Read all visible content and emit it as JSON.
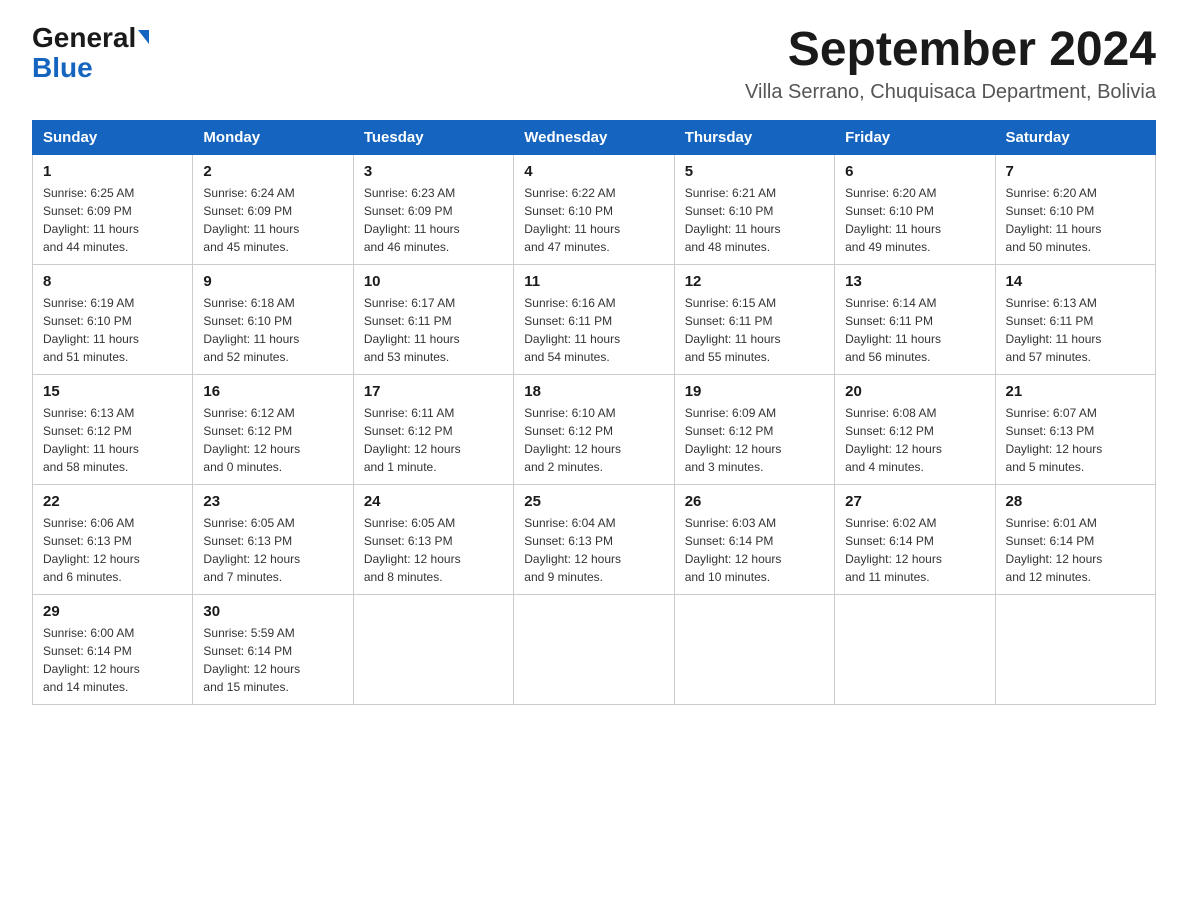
{
  "logo": {
    "general": "General",
    "blue": "Blue",
    "arrow": "▼"
  },
  "header": {
    "month": "September 2024",
    "location": "Villa Serrano, Chuquisaca Department, Bolivia"
  },
  "days_of_week": [
    "Sunday",
    "Monday",
    "Tuesday",
    "Wednesday",
    "Thursday",
    "Friday",
    "Saturday"
  ],
  "weeks": [
    [
      {
        "day": "1",
        "sunrise": "6:25 AM",
        "sunset": "6:09 PM",
        "daylight": "11 hours and 44 minutes."
      },
      {
        "day": "2",
        "sunrise": "6:24 AM",
        "sunset": "6:09 PM",
        "daylight": "11 hours and 45 minutes."
      },
      {
        "day": "3",
        "sunrise": "6:23 AM",
        "sunset": "6:09 PM",
        "daylight": "11 hours and 46 minutes."
      },
      {
        "day": "4",
        "sunrise": "6:22 AM",
        "sunset": "6:10 PM",
        "daylight": "11 hours and 47 minutes."
      },
      {
        "day": "5",
        "sunrise": "6:21 AM",
        "sunset": "6:10 PM",
        "daylight": "11 hours and 48 minutes."
      },
      {
        "day": "6",
        "sunrise": "6:20 AM",
        "sunset": "6:10 PM",
        "daylight": "11 hours and 49 minutes."
      },
      {
        "day": "7",
        "sunrise": "6:20 AM",
        "sunset": "6:10 PM",
        "daylight": "11 hours and 50 minutes."
      }
    ],
    [
      {
        "day": "8",
        "sunrise": "6:19 AM",
        "sunset": "6:10 PM",
        "daylight": "11 hours and 51 minutes."
      },
      {
        "day": "9",
        "sunrise": "6:18 AM",
        "sunset": "6:10 PM",
        "daylight": "11 hours and 52 minutes."
      },
      {
        "day": "10",
        "sunrise": "6:17 AM",
        "sunset": "6:11 PM",
        "daylight": "11 hours and 53 minutes."
      },
      {
        "day": "11",
        "sunrise": "6:16 AM",
        "sunset": "6:11 PM",
        "daylight": "11 hours and 54 minutes."
      },
      {
        "day": "12",
        "sunrise": "6:15 AM",
        "sunset": "6:11 PM",
        "daylight": "11 hours and 55 minutes."
      },
      {
        "day": "13",
        "sunrise": "6:14 AM",
        "sunset": "6:11 PM",
        "daylight": "11 hours and 56 minutes."
      },
      {
        "day": "14",
        "sunrise": "6:13 AM",
        "sunset": "6:11 PM",
        "daylight": "11 hours and 57 minutes."
      }
    ],
    [
      {
        "day": "15",
        "sunrise": "6:13 AM",
        "sunset": "6:12 PM",
        "daylight": "11 hours and 58 minutes."
      },
      {
        "day": "16",
        "sunrise": "6:12 AM",
        "sunset": "6:12 PM",
        "daylight": "12 hours and 0 minutes."
      },
      {
        "day": "17",
        "sunrise": "6:11 AM",
        "sunset": "6:12 PM",
        "daylight": "12 hours and 1 minute."
      },
      {
        "day": "18",
        "sunrise": "6:10 AM",
        "sunset": "6:12 PM",
        "daylight": "12 hours and 2 minutes."
      },
      {
        "day": "19",
        "sunrise": "6:09 AM",
        "sunset": "6:12 PM",
        "daylight": "12 hours and 3 minutes."
      },
      {
        "day": "20",
        "sunrise": "6:08 AM",
        "sunset": "6:12 PM",
        "daylight": "12 hours and 4 minutes."
      },
      {
        "day": "21",
        "sunrise": "6:07 AM",
        "sunset": "6:13 PM",
        "daylight": "12 hours and 5 minutes."
      }
    ],
    [
      {
        "day": "22",
        "sunrise": "6:06 AM",
        "sunset": "6:13 PM",
        "daylight": "12 hours and 6 minutes."
      },
      {
        "day": "23",
        "sunrise": "6:05 AM",
        "sunset": "6:13 PM",
        "daylight": "12 hours and 7 minutes."
      },
      {
        "day": "24",
        "sunrise": "6:05 AM",
        "sunset": "6:13 PM",
        "daylight": "12 hours and 8 minutes."
      },
      {
        "day": "25",
        "sunrise": "6:04 AM",
        "sunset": "6:13 PM",
        "daylight": "12 hours and 9 minutes."
      },
      {
        "day": "26",
        "sunrise": "6:03 AM",
        "sunset": "6:14 PM",
        "daylight": "12 hours and 10 minutes."
      },
      {
        "day": "27",
        "sunrise": "6:02 AM",
        "sunset": "6:14 PM",
        "daylight": "12 hours and 11 minutes."
      },
      {
        "day": "28",
        "sunrise": "6:01 AM",
        "sunset": "6:14 PM",
        "daylight": "12 hours and 12 minutes."
      }
    ],
    [
      {
        "day": "29",
        "sunrise": "6:00 AM",
        "sunset": "6:14 PM",
        "daylight": "12 hours and 14 minutes."
      },
      {
        "day": "30",
        "sunrise": "5:59 AM",
        "sunset": "6:14 PM",
        "daylight": "12 hours and 15 minutes."
      },
      null,
      null,
      null,
      null,
      null
    ]
  ],
  "labels": {
    "sunrise": "Sunrise:",
    "sunset": "Sunset:",
    "daylight": "Daylight:"
  }
}
